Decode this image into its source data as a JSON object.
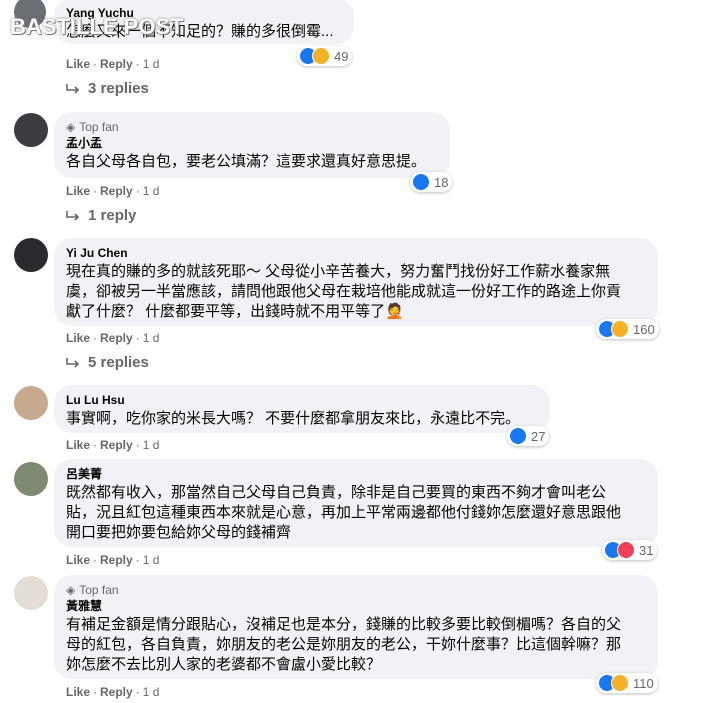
{
  "watermark": "BASTILLE POST",
  "actions": {
    "like": "Like",
    "reply": "Reply",
    "sep": "·"
  },
  "comments": [
    {
      "name": "Yang Yuchu",
      "top_fan": false,
      "text": "怎麼又來一個不知足的？賺的多很倒霉...",
      "time": "1 d",
      "reactions": [
        "like",
        "haha"
      ],
      "count": "49",
      "replies": "3 replies"
    },
    {
      "name": "孟小孟",
      "top_fan": true,
      "top_fan_label": "Top fan",
      "text": "各自父母各自包，要老公填滿？這要求還真好意思提。",
      "time": "1 d",
      "reactions": [
        "like"
      ],
      "count": "18",
      "replies": "1 reply"
    },
    {
      "name": "Yi Ju Chen",
      "top_fan": false,
      "text": "現在真的賺的多的就該死耶～ 父母從小辛苦養大，努力奮鬥找份好工作薪水養家無\n虞，卻被另一半當應該，請問他跟他父母在栽培他能成就這一份好工作的路途上你貢\n獻了什麼？ 什麼都要平等，出錢時就不用平等了🤦",
      "time": "1 d",
      "reactions": [
        "like",
        "haha"
      ],
      "count": "160",
      "replies": "5 replies"
    },
    {
      "name": "Lu Lu Hsu",
      "top_fan": false,
      "text": "事實啊，吃你家的米長大嗎？ 不要什麼都拿朋友來比，永遠比不完。",
      "time": "1 d",
      "reactions": [
        "like"
      ],
      "count": "27"
    },
    {
      "name": "呂美菁",
      "top_fan": false,
      "text": "既然都有收入，那當然自己父母自己負責，除非是自己要買的東西不夠才會叫老公\n貼，況且紅包這種東西本來就是心意，再加上平常兩邊都他付錢妳怎麼還好意思跟他\n開口要把妳要包給妳父母的錢補齊",
      "time": "1 d",
      "reactions": [
        "like",
        "love"
      ],
      "count": "31"
    },
    {
      "name": "黃雅慧",
      "top_fan": true,
      "top_fan_label": "Top fan",
      "text": "有補足金額是情分跟貼心，沒補足也是本分，錢賺的比較多要比較倒楣嗎？各自的父\n母的紅包，各自負責，妳朋友的老公是妳朋友的老公，干妳什麼事？比這個幹嘛？那\n妳怎麼不去比別人家的老婆都不會盧小愛比較？",
      "time": "1 d",
      "reactions": [
        "like",
        "haha"
      ],
      "count": "110"
    }
  ],
  "colors": {
    "like": "#1877f2",
    "haha": "#f7b125",
    "love": "#f33e58",
    "bubble": "#f0f2f5",
    "meta": "#65676b"
  }
}
